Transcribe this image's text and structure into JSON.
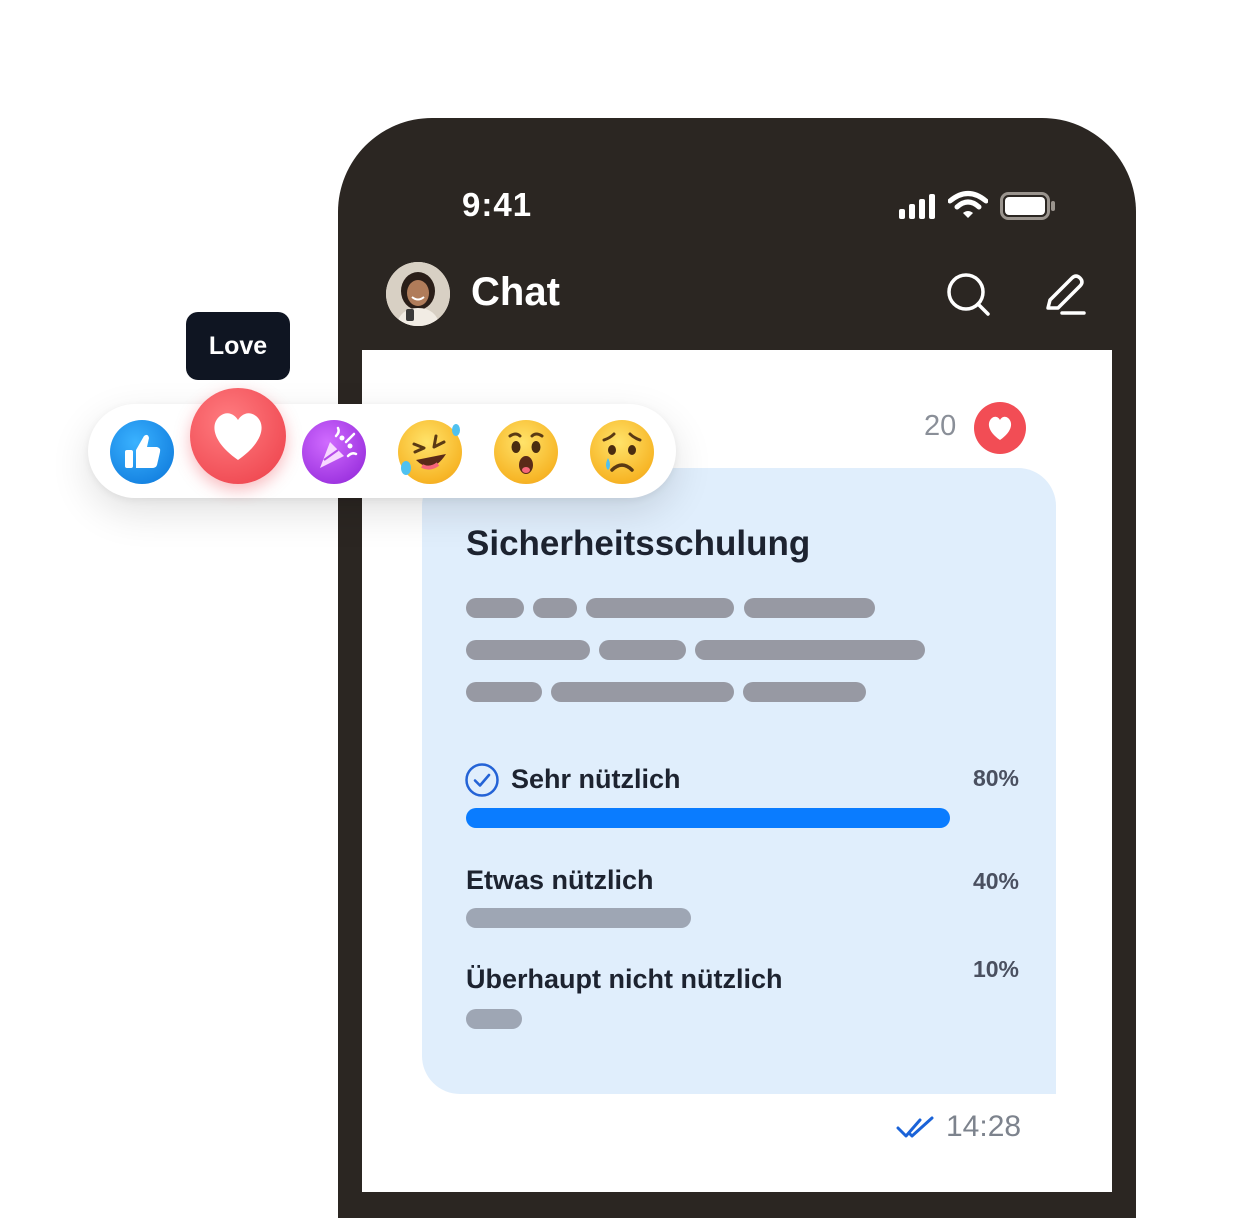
{
  "status_bar": {
    "time": "9:41"
  },
  "header": {
    "title": "Chat"
  },
  "message": {
    "reaction_count": "20",
    "title": "Sicherheitsschulung",
    "poll": [
      {
        "label": "Sehr nützlich",
        "percent": "80%",
        "fill": 0.8,
        "selected": true
      },
      {
        "label": "Etwas nützlich",
        "percent": "40%",
        "fill": 0.4,
        "selected": false
      },
      {
        "label": "Überhaupt nicht nützlich",
        "percent": "10%",
        "fill": 0.1,
        "selected": false
      }
    ],
    "time": "14:28"
  },
  "reactions": {
    "tooltip": "Love",
    "items": [
      "like-icon",
      "love-icon",
      "party-icon",
      "laugh-icon",
      "wow-icon",
      "sad-icon"
    ]
  },
  "colors": {
    "phone_frame": "#2b2622",
    "bubble": "#e0eefc",
    "accent": "#0a7cff",
    "bar_neutral": "#9ea6b4",
    "heart": "#f24d55"
  }
}
